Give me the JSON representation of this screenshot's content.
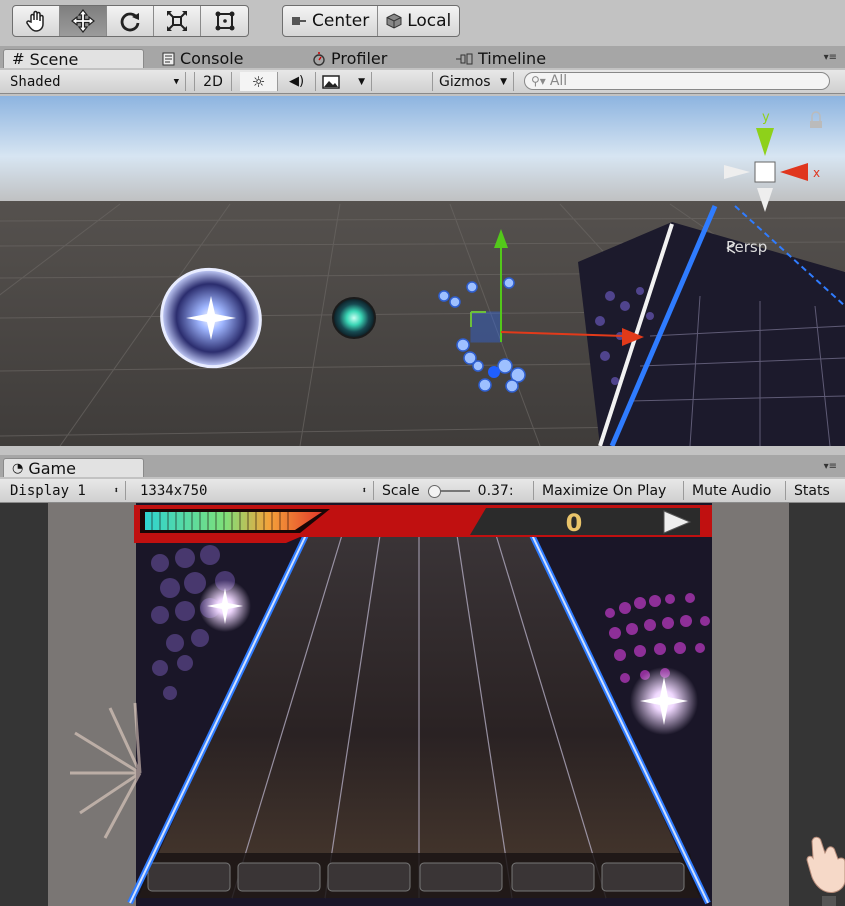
{
  "toolbar": {
    "tools": [
      {
        "name": "hand-tool",
        "icon": "hand-icon"
      },
      {
        "name": "move-tool",
        "icon": "move-arrows-icon",
        "active": true
      },
      {
        "name": "rotate-tool",
        "icon": "rotate-icon"
      },
      {
        "name": "scale-tool",
        "icon": "scale-icon"
      },
      {
        "name": "rect-tool",
        "icon": "rect-icon"
      }
    ],
    "pivot_label": "Center",
    "space_label": "Local"
  },
  "top_tabs": {
    "scene": "Scene",
    "console": "Console",
    "profiler": "Profiler",
    "timeline": "Timeline"
  },
  "scene_toolbar": {
    "draw_mode": "Shaded",
    "mode_2d": "2D",
    "gizmos": "Gizmos",
    "search_placeholder": "All"
  },
  "scene_view": {
    "gizmo_y_label": "y",
    "gizmo_x_label": "x",
    "projection_label": "Persp"
  },
  "game_tab": {
    "title": "Game"
  },
  "game_toolbar": {
    "display": "Display 1",
    "resolution": "1334x750",
    "scale_label": "Scale",
    "scale_value": "0.37:",
    "maximize": "Maximize On Play",
    "mute": "Mute Audio",
    "stats": "Stats"
  },
  "game_view": {
    "score": "0"
  },
  "colors": {
    "editor_bg": "#c2c2c2",
    "tab_bar": "#a6a6a6",
    "lane_blue": "#2f7cff",
    "hud_red": "#c01010",
    "score_gold": "#e9c46a"
  }
}
